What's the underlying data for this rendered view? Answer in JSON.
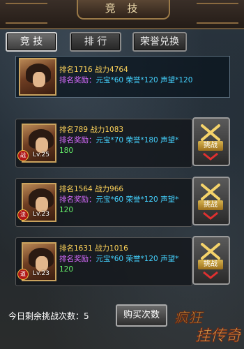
{
  "header": {
    "title": "竞 技"
  },
  "tabs": [
    {
      "label": "竞 技",
      "active": true
    },
    {
      "label": "排 行",
      "active": false
    },
    {
      "label": "荣誉兑换",
      "active": false
    }
  ],
  "self": {
    "rank_line": "排名1716 战力4764",
    "reward_label": "排名奖励：",
    "reward_value": "元宝*60 荣誉*120 声望*120"
  },
  "opponents": [
    {
      "rank_line": "排名789 战力1083",
      "reward_label": "排名奖励：",
      "reward_value": "元宝*70 荣誉*180 声望*",
      "reward_overflow": "180",
      "level": "Lv.25",
      "job": "战"
    },
    {
      "rank_line": "排名1564 战力966",
      "reward_label": "排名奖励：",
      "reward_value": "元宝*60 荣誉*120 声望*",
      "reward_overflow": "120",
      "level": "Lv.23",
      "job": "法"
    },
    {
      "rank_line": "排名1631 战力1016",
      "reward_label": "排名奖励：",
      "reward_value": "元宝*60 荣誉*120 声望*",
      "reward_overflow": "120",
      "level": "Lv.23",
      "job": "道"
    }
  ],
  "fight_label": "挑战",
  "footer": {
    "remaining_label": "今日剩余挑战次数：",
    "remaining_value": "5",
    "buy_label": "购买次数",
    "logo_text": "疯狂挂传奇"
  },
  "colors": {
    "rank_text": "#ffd45a",
    "reward_label": "#d86bff",
    "reward_value": "#44d2ff",
    "overflow": "#66f06a"
  }
}
